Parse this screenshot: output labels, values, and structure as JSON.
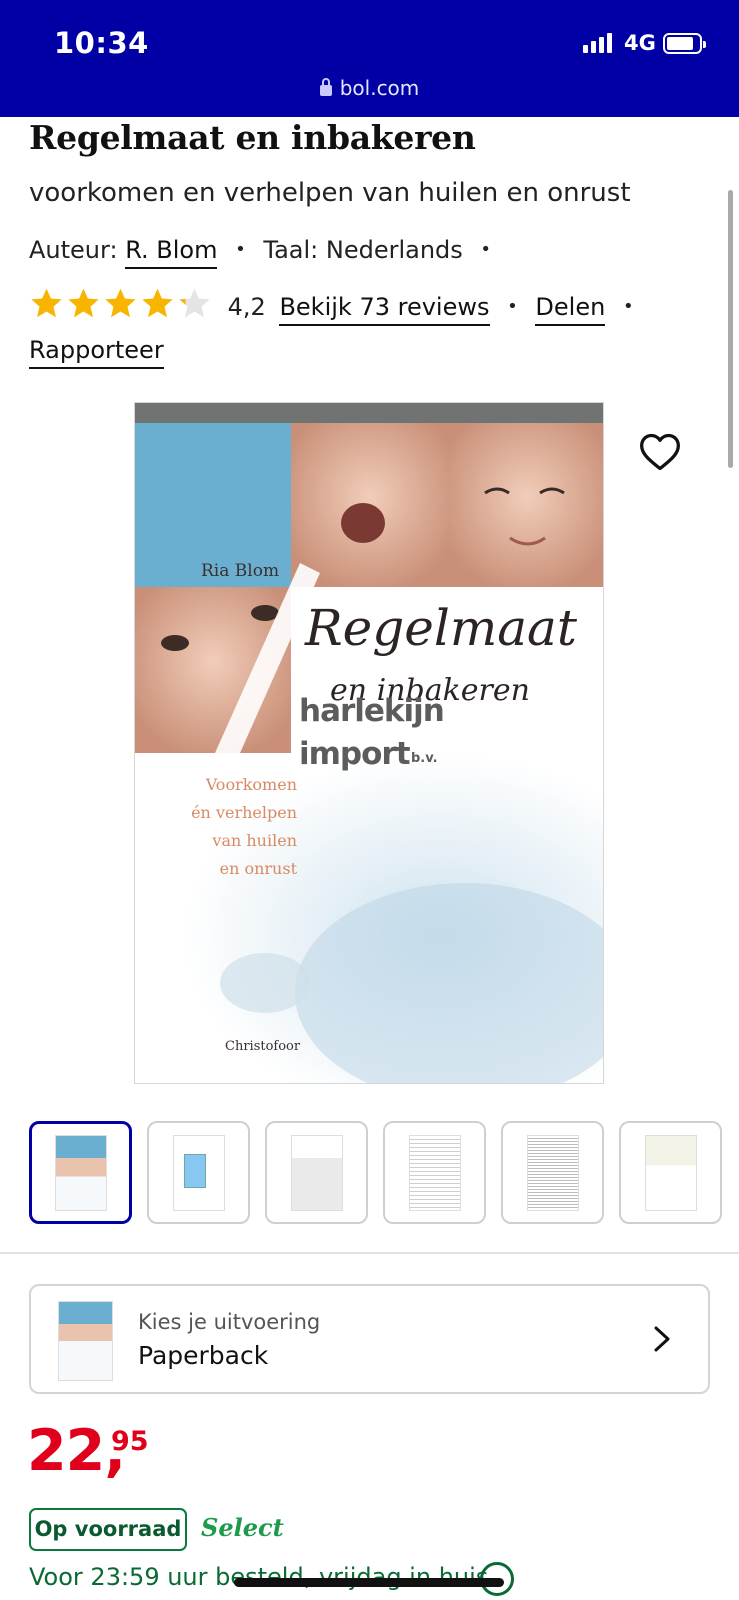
{
  "status_bar": {
    "time": "10:34",
    "network": "4G",
    "url": "bol.com"
  },
  "product": {
    "title": "Regelmaat en inbakeren",
    "subtitle": "voorkomen en verhelpen van huilen en onrust",
    "author_label": "Auteur:",
    "author_name": "R. Blom",
    "language": "Taal: Nederlands",
    "rating_value": "4,2",
    "rating_stars": 4.2,
    "reviews_link": "Bekijk 73 reviews",
    "share_link": "Delen",
    "report_link": "Rapporteer"
  },
  "cover": {
    "author": "Ria Blom",
    "title_line1": "Regelmaat",
    "title_line2": "en inbakeren",
    "watermark_line1": "harlekijn",
    "watermark_line2": "import",
    "watermark_suffix": "b.v.",
    "tagline_1": "Voorkomen",
    "tagline_2": "én verhelpen",
    "tagline_3": "van huilen",
    "tagline_4": "en onrust",
    "publisher": "Christofoor"
  },
  "variant": {
    "label": "Kies je uitvoering",
    "value": "Paperback"
  },
  "price": {
    "integer": "22,",
    "decimals": "95"
  },
  "availability": {
    "stock_label": "Op voorraad",
    "select_label": "Select",
    "delivery": "Voor 23:59 uur besteld, vrijdag in huis"
  },
  "colors": {
    "brand": "#0000a4",
    "price": "#e0001b",
    "stock": "#0a7a3c",
    "star": "#f7b500"
  }
}
